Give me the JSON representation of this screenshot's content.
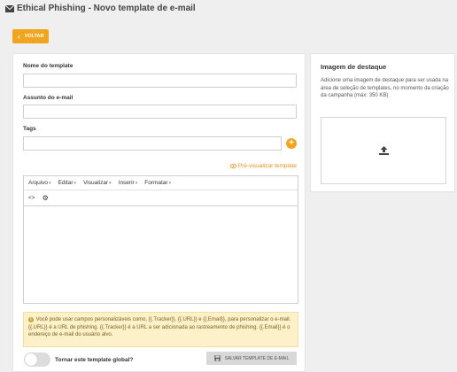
{
  "header": {
    "title": "Ethical Phishing - Novo template de e-mail",
    "icon": "envelope-icon"
  },
  "back_button": {
    "label": "VOLTAR",
    "icon": "chevron-left-icon",
    "color": "#f0a51e"
  },
  "form": {
    "name_label": "Nome do template",
    "name_value": "",
    "subject_label": "Assunto do e-mail",
    "subject_value": "",
    "tags_label": "Tags",
    "tags_value": "",
    "preview_link": "Pré-visualizar template",
    "editor": {
      "menus": [
        "Arquivo",
        "Editar",
        "Visualizar",
        "Inserir",
        "Formatar"
      ],
      "tools": [
        "code-icon",
        "gear-icon"
      ]
    },
    "info_text": "Você pode usar campos personalizáveis como, {{.Tracker}}, {{.URL}} e {{.Email}}, para personalizar o e-mail. {{.URL}} é a URL de phishing. {{.Tracker}} é a URL a ser adicionada ao rastreamento de phishing. {{.Email}} é o endereço de e-mail do usuário alvo.",
    "global_toggle_label": "Tornar este template global?",
    "global_toggle_on": false,
    "save_button": "SALVAR TEMPLATE DE E-MAIL"
  },
  "featured_image": {
    "title": "Imagem de destaque",
    "description": "Adicione uma imagem de destaque para ser usada na área de seleção de templates, no momento da criação da campanha (máx: 350 KB)",
    "upload_icon": "upload-icon"
  }
}
